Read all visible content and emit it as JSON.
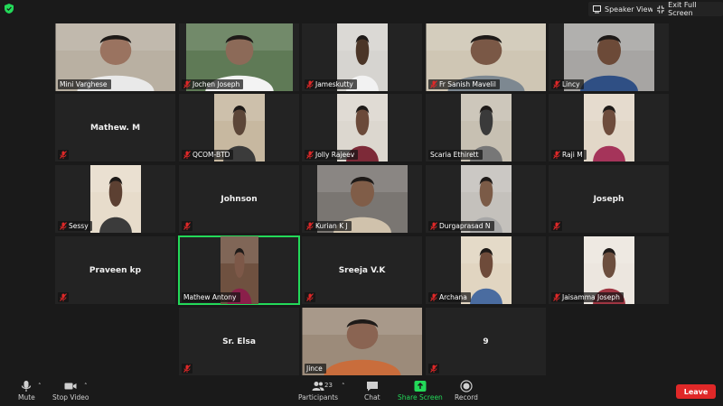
{
  "topbar": {
    "security_icon": "shield-check-icon",
    "speaker_view_label": "Speaker View",
    "exit_full_screen_label": "Exit Full Screen"
  },
  "participants": [
    {
      "name": "Mini Varghese",
      "video": true,
      "muted": false,
      "active": false
    },
    {
      "name": "Jochen Joseph",
      "video": true,
      "muted": true,
      "active": false
    },
    {
      "name": "Jameskutty",
      "video": true,
      "muted": true,
      "active": false
    },
    {
      "name": "Fr Sanish Mavelil",
      "video": true,
      "muted": true,
      "active": false
    },
    {
      "name": "Lincy",
      "video": true,
      "muted": true,
      "active": false
    },
    {
      "name": "Mathew. M",
      "video": false,
      "muted": true,
      "active": false
    },
    {
      "name": "QCOM-BTD",
      "video": true,
      "muted": true,
      "active": false
    },
    {
      "name": "Jolly Rajeev",
      "video": true,
      "muted": true,
      "active": false
    },
    {
      "name": "Scaria Ethirett",
      "video": true,
      "muted": false,
      "active": false
    },
    {
      "name": "Raji M",
      "video": true,
      "muted": true,
      "active": false
    },
    {
      "name": "Sessy",
      "video": true,
      "muted": true,
      "active": false
    },
    {
      "name": "Johnson",
      "video": false,
      "muted": true,
      "active": false
    },
    {
      "name": "Kurian K J",
      "video": true,
      "muted": true,
      "active": false
    },
    {
      "name": "Durgaprasad N",
      "video": true,
      "muted": true,
      "active": false
    },
    {
      "name": "Joseph",
      "video": false,
      "muted": true,
      "active": false
    },
    {
      "name": "Praveen kp",
      "video": false,
      "muted": true,
      "active": false
    },
    {
      "name": "Mathew Antony",
      "video": true,
      "muted": false,
      "active": true
    },
    {
      "name": "Sreeja V.K",
      "video": false,
      "muted": true,
      "active": false
    },
    {
      "name": "Archana",
      "video": true,
      "muted": true,
      "active": false
    },
    {
      "name": "Jaisamma Joseph",
      "video": true,
      "muted": true,
      "active": false
    },
    {
      "name": "Sr. Elsa",
      "video": false,
      "muted": true,
      "active": false
    },
    {
      "name": "Jince",
      "video": true,
      "muted": false,
      "active": false
    },
    {
      "name": "9",
      "video": false,
      "muted": true,
      "active": false
    }
  ],
  "toolbar": {
    "mute_label": "Mute",
    "stop_video_label": "Stop Video",
    "participants_label": "Participants",
    "participants_count": "23",
    "chat_label": "Chat",
    "share_screen_label": "Share Screen",
    "record_label": "Record",
    "leave_label": "Leave"
  },
  "colors": {
    "background": "#1a1a1a",
    "tile": "#232323",
    "active_speaker": "#23d959",
    "muted_icon": "#e02828",
    "share_screen": "#23d959",
    "leave": "#e02828"
  }
}
